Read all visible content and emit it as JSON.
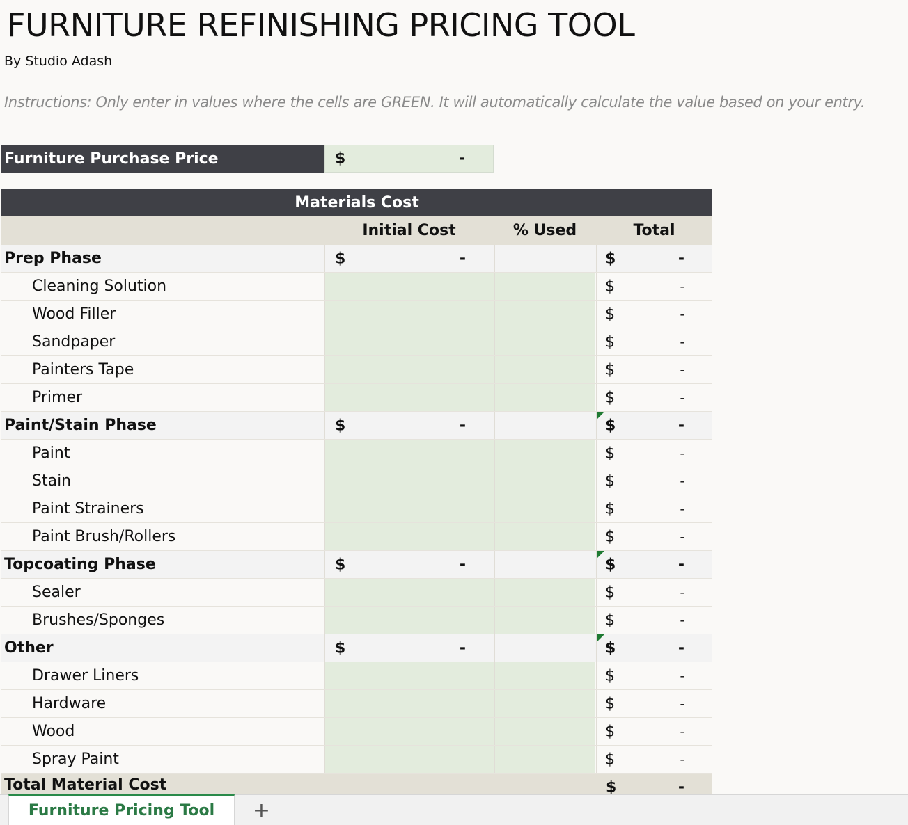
{
  "title": "FURNITURE REFINISHING PRICING TOOL",
  "byline": "By Studio Adash",
  "instructions": "Instructions:  Only enter in values where the cells are GREEN.  It will automatically calculate the value based on your entry.",
  "purchase": {
    "label": "Furniture Purchase Price",
    "currency": "$",
    "value": "-"
  },
  "materials": {
    "header": "Materials Cost",
    "columns": {
      "initial_cost": "Initial Cost",
      "percent_used": "% Used",
      "total": "Total"
    },
    "currency": "$",
    "empty_value": "-",
    "rows": [
      {
        "type": "phase",
        "label": "Prep Phase",
        "flag": false
      },
      {
        "type": "item",
        "label": "Cleaning Solution"
      },
      {
        "type": "item",
        "label": "Wood Filler"
      },
      {
        "type": "item",
        "label": "Sandpaper"
      },
      {
        "type": "item",
        "label": "Painters Tape"
      },
      {
        "type": "item",
        "label": "Primer"
      },
      {
        "type": "phase",
        "label": "Paint/Stain Phase",
        "flag": true
      },
      {
        "type": "item",
        "label": "Paint"
      },
      {
        "type": "item",
        "label": "Stain"
      },
      {
        "type": "item",
        "label": "Paint Strainers"
      },
      {
        "type": "item",
        "label": "Paint Brush/Rollers"
      },
      {
        "type": "phase",
        "label": "Topcoating Phase",
        "flag": true
      },
      {
        "type": "item",
        "label": "Sealer"
      },
      {
        "type": "item",
        "label": "Brushes/Sponges"
      },
      {
        "type": "phase",
        "label": "Other",
        "flag": true
      },
      {
        "type": "item",
        "label": "Drawer Liners"
      },
      {
        "type": "item",
        "label": "Hardware"
      },
      {
        "type": "item",
        "label": "Wood"
      },
      {
        "type": "item",
        "label": "Spray Paint"
      }
    ],
    "total": {
      "label": "Total Material Cost",
      "currency": "$",
      "value": "-"
    }
  },
  "sheet_tabs": {
    "active": "Furniture Pricing Tool",
    "add_label": "+"
  },
  "colors": {
    "dark_header": "#3f4046",
    "input_green": "#e3ecdd",
    "column_header_bg": "#e3e0d6",
    "comment_flag": "#1e7a32",
    "tab_accent": "#2b7a45"
  }
}
